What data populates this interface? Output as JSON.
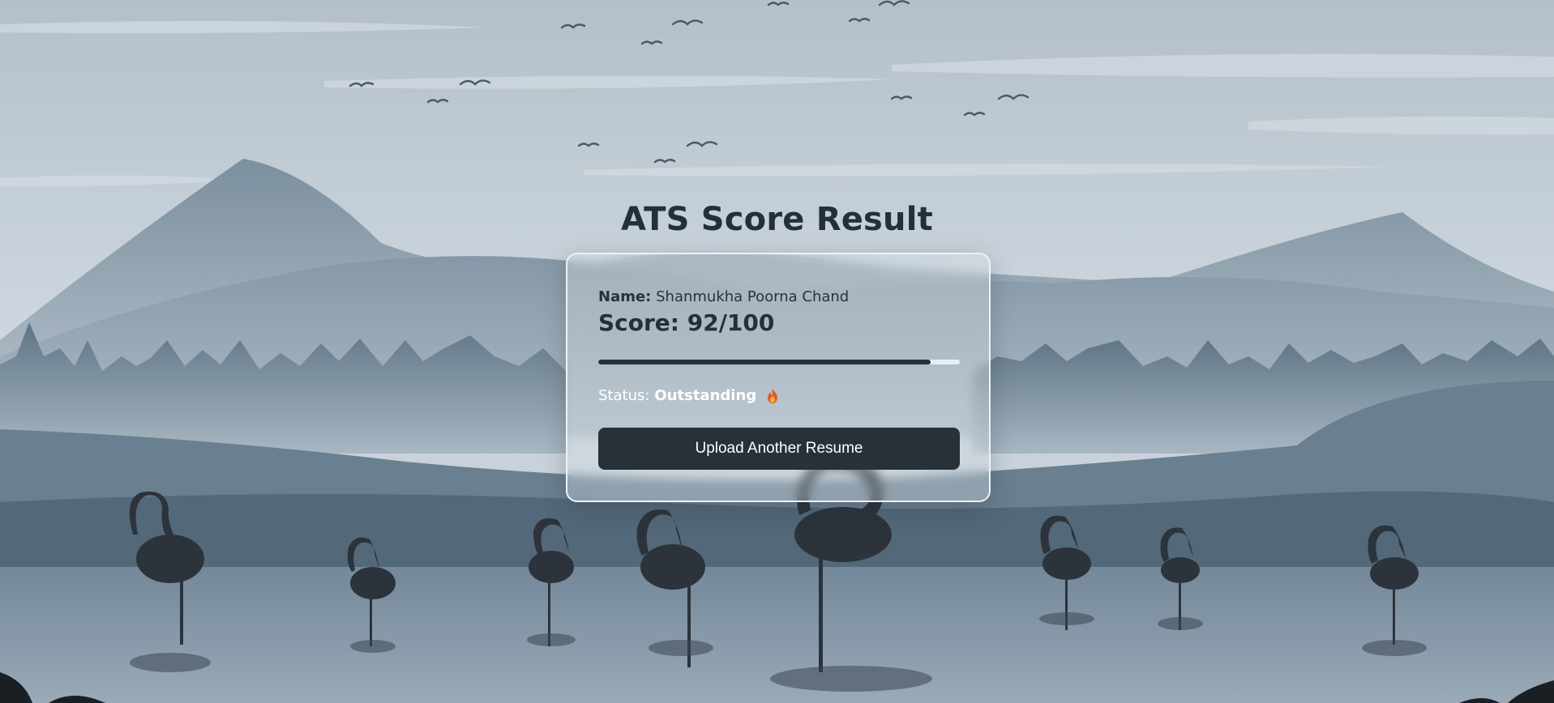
{
  "page": {
    "title": "ATS Score Result"
  },
  "result": {
    "name_label": "Name:",
    "name_value": "Shanmukha Poorna Chand",
    "score_text": "Score: 92/100",
    "score": 92,
    "score_max": 100,
    "status_label": "Status:",
    "status_value": "Outstanding",
    "status_icon": "fire-icon"
  },
  "actions": {
    "upload_label": "Upload Another Resume"
  },
  "colors": {
    "accent": "#283038",
    "title": "#243039",
    "card_border": "#eef2f5",
    "sky": "#c6d0d8"
  }
}
